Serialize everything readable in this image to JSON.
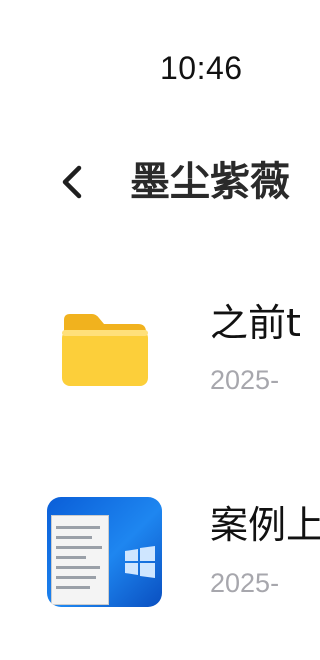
{
  "status_bar": {
    "time": "10:46"
  },
  "header": {
    "title": "墨尘紫薇"
  },
  "items": [
    {
      "title": "之前𝗍",
      "meta": "2025-",
      "icon": "folder-icon"
    },
    {
      "title": "案例上",
      "meta": "2025-",
      "icon": "image-thumbnail"
    }
  ],
  "colors": {
    "folder_yellow": "#f9c72c",
    "meta_gray": "#a7a7ad",
    "text": "#111111"
  }
}
